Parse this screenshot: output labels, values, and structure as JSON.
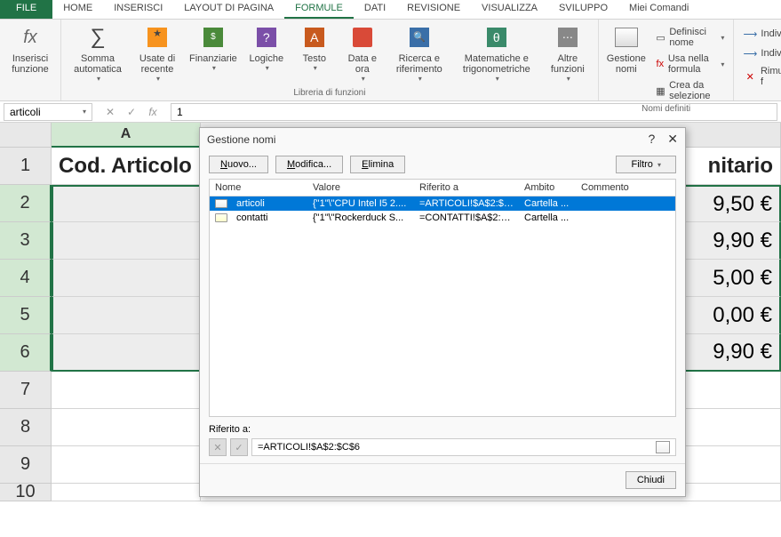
{
  "tabs": {
    "file": "FILE",
    "home": "HOME",
    "inserisci": "INSERISCI",
    "layout": "LAYOUT DI PAGINA",
    "formule": "FORMULE",
    "dati": "DATI",
    "revisione": "REVISIONE",
    "visualizza": "VISUALIZZA",
    "sviluppo": "SVILUPPO",
    "miei": "Miei Comandi"
  },
  "ribbon": {
    "inserisci_funzione": "Inserisci funzione",
    "somma_automatica": "Somma automatica",
    "usate_recente": "Usate di recente",
    "finanziarie": "Finanziarie",
    "logiche": "Logiche",
    "testo": "Testo",
    "data_ora": "Data e ora",
    "ricerca": "Ricerca e riferimento",
    "matematiche": "Matematiche e trigonometriche",
    "altre": "Altre funzioni",
    "gestione_nomi": "Gestione nomi",
    "definisci_nome": "Definisci nome",
    "usa_formula": "Usa nella formula",
    "crea_selezione": "Crea da selezione",
    "individua": "Individua",
    "individua2": "Individua",
    "rimuovi": "Rimuovi f",
    "libreria_label": "Libreria di funzioni",
    "nomi_label": "Nomi definiti"
  },
  "formula_bar": {
    "name_box": "articoli",
    "formula": "1"
  },
  "sheet": {
    "col_a": "A",
    "header_a": "Cod. Articolo",
    "header_price": "nitario",
    "prices": [
      "9,50 €",
      "9,90 €",
      "5,00 €",
      "0,00 €",
      "9,90 €"
    ],
    "rows": [
      "1",
      "2",
      "3",
      "4",
      "5",
      "6",
      "7",
      "8",
      "9",
      "10"
    ]
  },
  "dialog": {
    "title": "Gestione nomi",
    "nuovo": "Nuovo...",
    "modifica": "Modifica...",
    "elimina": "Elimina",
    "filtro": "Filtro",
    "headers": {
      "nome": "Nome",
      "valore": "Valore",
      "riferito": "Riferito a",
      "ambito": "Ambito",
      "commento": "Commento"
    },
    "rows": [
      {
        "nome": "articoli",
        "valore": "{\"1\"\\\"CPU Intel I5 2....",
        "riferito": "=ARTICOLI!$A$2:$C...",
        "ambito": "Cartella ...",
        "commento": ""
      },
      {
        "nome": "contatti",
        "valore": "{\"1\"\\\"Rockerduck S...",
        "riferito": "=CONTATTI!$A$2:$...",
        "ambito": "Cartella ...",
        "commento": ""
      }
    ],
    "riferito_label": "Riferito a:",
    "riferito_value": "=ARTICOLI!$A$2:$C$6",
    "chiudi": "Chiudi"
  }
}
